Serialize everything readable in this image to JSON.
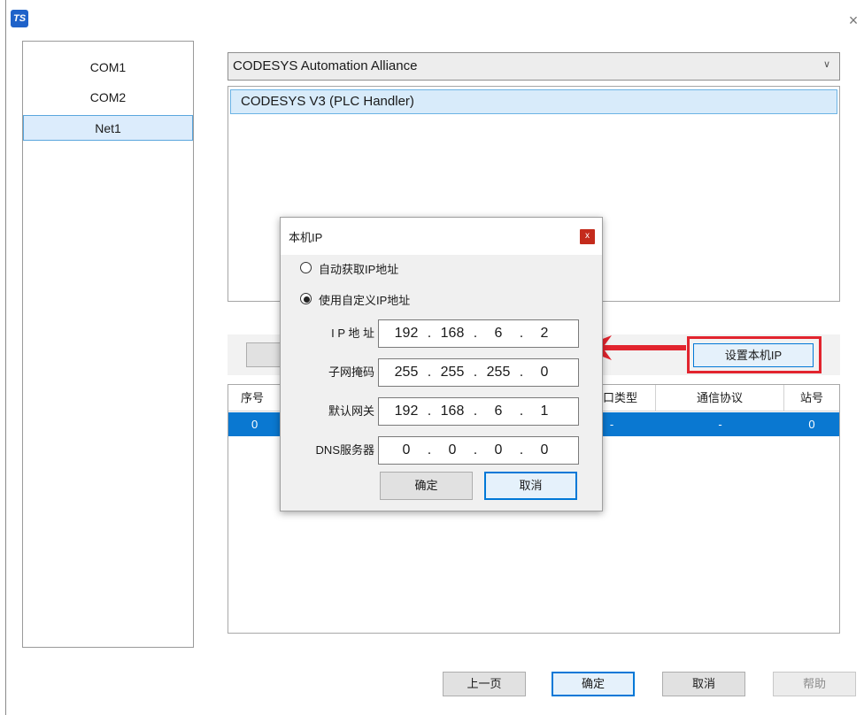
{
  "window": {
    "app_icon_text": "TS",
    "close_glyph": "×"
  },
  "ports": [
    {
      "label": "COM1",
      "selected": false
    },
    {
      "label": "COM2",
      "selected": false
    },
    {
      "label": "Net1",
      "selected": true
    }
  ],
  "vendor_select": {
    "value": "CODESYS Automation Alliance"
  },
  "protocols": [
    {
      "label": "CODESYS V3 (PLC Handler)",
      "selected": true
    }
  ],
  "set_local_ip_button": "设置本机IP",
  "table": {
    "headers": {
      "index": "序号",
      "port_type": "口类型",
      "protocol": "通信协议",
      "station": "站号"
    },
    "rows": [
      {
        "index": "0",
        "port_type": "-",
        "protocol": "-",
        "station": "0"
      }
    ]
  },
  "bottom_buttons": {
    "prev": "上一页",
    "ok": "确定",
    "cancel": "取消",
    "help": "帮助"
  },
  "dialog": {
    "title": "本机IP",
    "close_glyph": "x",
    "radio_auto": {
      "label": "自动获取IP地址",
      "checked": false
    },
    "radio_custom": {
      "label": "使用自定义IP地址",
      "checked": true
    },
    "fields": [
      {
        "label": "I P 地 址",
        "octets": [
          "192",
          "168",
          "6",
          "2"
        ]
      },
      {
        "label": "子网掩码",
        "octets": [
          "255",
          "255",
          "255",
          "0"
        ]
      },
      {
        "label": "默认网关",
        "octets": [
          "192",
          "168",
          "6",
          "1"
        ]
      },
      {
        "label": "DNS服务器",
        "octets": [
          "0",
          "0",
          "0",
          "0"
        ]
      }
    ],
    "ok_label": "确定",
    "cancel_label": "取消"
  },
  "colors": {
    "accent": "#0078d7",
    "selection": "#0a78d1",
    "highlight_red": "#e2242e"
  }
}
